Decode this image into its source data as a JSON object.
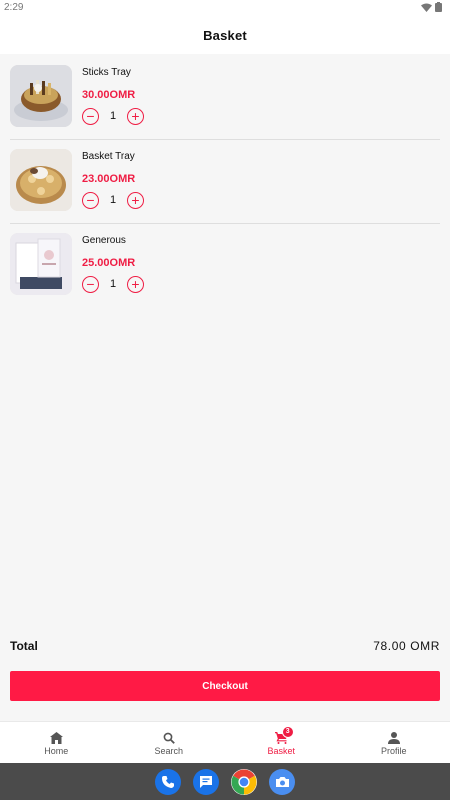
{
  "status": {
    "time": "2:29"
  },
  "header": {
    "title": "Basket"
  },
  "items": [
    {
      "name": "Sticks Tray",
      "price": "30.00OMR",
      "qty": "1",
      "minus": "−",
      "plus": "+"
    },
    {
      "name": "Basket Tray",
      "price": "23.00OMR",
      "qty": "1",
      "minus": "−",
      "plus": "+"
    },
    {
      "name": "Generous",
      "price": "25.00OMR",
      "qty": "1",
      "minus": "−",
      "plus": "+"
    }
  ],
  "summary": {
    "total_label": "Total",
    "total_value": "78.00 OMR"
  },
  "checkout": {
    "label": "Checkout"
  },
  "nav": {
    "items": [
      {
        "label": "Home",
        "icon": "home-icon"
      },
      {
        "label": "Search",
        "icon": "search-icon"
      },
      {
        "label": "Basket",
        "icon": "cart-icon",
        "badge": "3"
      },
      {
        "label": "Profile",
        "icon": "person-icon"
      }
    ]
  },
  "dock": [
    "phone-icon",
    "messages-icon",
    "chrome-icon",
    "camera-icon"
  ],
  "colors": {
    "accent": "#ef1d44",
    "button": "#ff1a45",
    "background": "#f6f6f6"
  }
}
